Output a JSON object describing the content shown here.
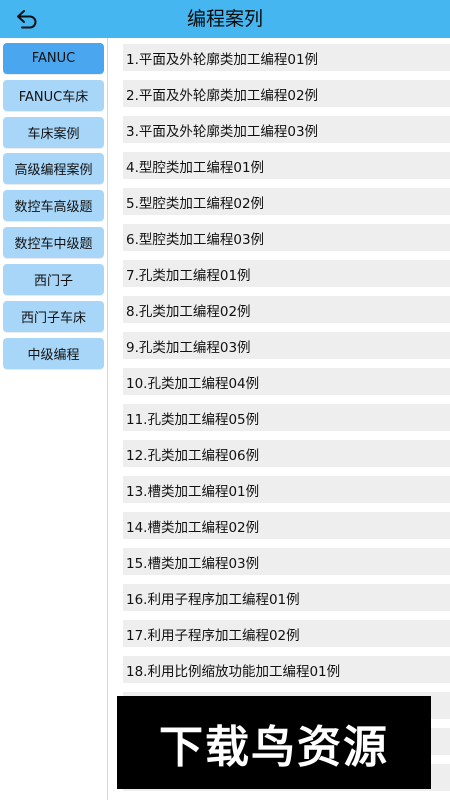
{
  "header": {
    "title": "编程案列",
    "back_icon": "back-arrow-icon"
  },
  "sidebar": {
    "items": [
      {
        "label": "FANUC"
      },
      {
        "label": "FANUC车床"
      },
      {
        "label": "车床案例"
      },
      {
        "label": "高级编程案例"
      },
      {
        "label": "数控车高级题"
      },
      {
        "label": "数控车中级题"
      },
      {
        "label": "西门子"
      },
      {
        "label": "西门子车床"
      },
      {
        "label": "中级编程"
      }
    ],
    "selected_index": 0
  },
  "cases": {
    "items": [
      {
        "label": "1.平面及外轮廓类加工编程01例"
      },
      {
        "label": "2.平面及外轮廓类加工编程02例"
      },
      {
        "label": "3.平面及外轮廓类加工编程03例"
      },
      {
        "label": "4.型腔类加工编程01例"
      },
      {
        "label": "5.型腔类加工编程02例"
      },
      {
        "label": "6.型腔类加工编程03例"
      },
      {
        "label": "7.孔类加工编程01例"
      },
      {
        "label": "8.孔类加工编程02例"
      },
      {
        "label": "9.孔类加工编程03例"
      },
      {
        "label": "10.孔类加工编程04例"
      },
      {
        "label": "11.孔类加工编程05例"
      },
      {
        "label": "12.孔类加工编程06例"
      },
      {
        "label": "13.槽类加工编程01例"
      },
      {
        "label": "14.槽类加工编程02例"
      },
      {
        "label": "15.槽类加工编程03例"
      },
      {
        "label": "16.利用子程序加工编程01例"
      },
      {
        "label": "17.利用子程序加工编程02例"
      },
      {
        "label": "18.利用比例缩放功能加工编程01例"
      },
      {
        "label": ""
      },
      {
        "label": ""
      },
      {
        "label": ""
      }
    ]
  },
  "watermark": {
    "text": "下载鸟资源"
  },
  "colors": {
    "header_bg": "#45b6f0",
    "sidebar_selected": "#4aa6ee",
    "sidebar_item": "#a8d6f8",
    "row_bg": "#eeeeee"
  }
}
